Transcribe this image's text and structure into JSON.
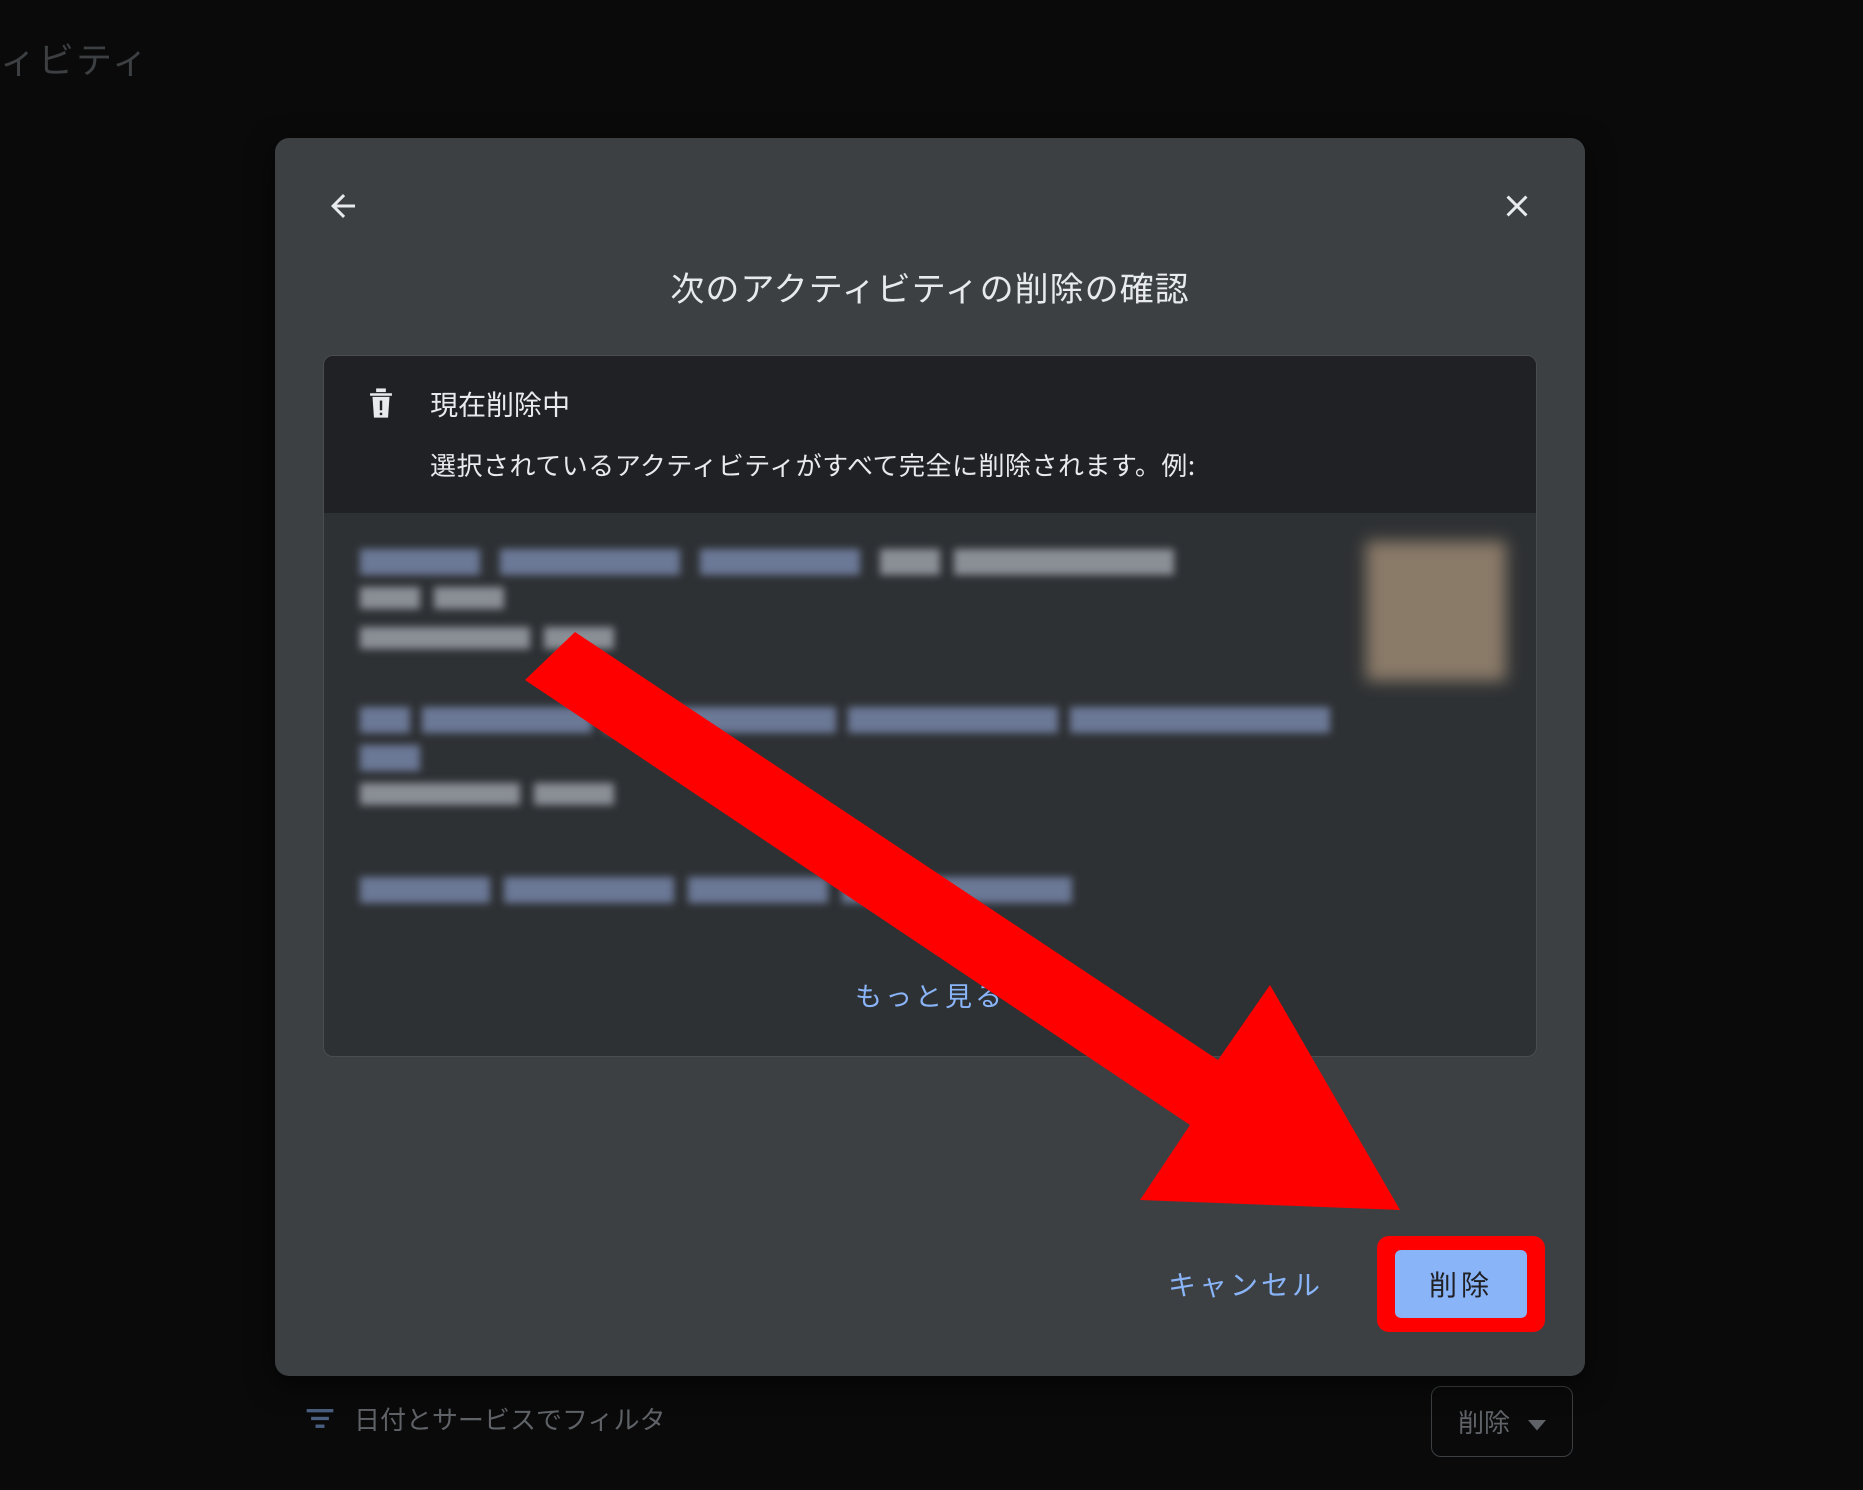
{
  "background": {
    "partial_heading": "ィビティ",
    "filter_label": "日付とサービスでフィルタ",
    "delete_chip": "削除"
  },
  "dialog": {
    "title": "次のアクティビティの削除の確認",
    "notice": {
      "title": "現在削除中",
      "description": "選択されているアクティビティがすべて完全に削除されます。例:"
    },
    "more_link": "もっと見る",
    "actions": {
      "cancel": "キャンセル",
      "delete": "削除"
    }
  },
  "annotation": {
    "highlight_target": "delete-button",
    "highlight_color": "#ff0000"
  }
}
